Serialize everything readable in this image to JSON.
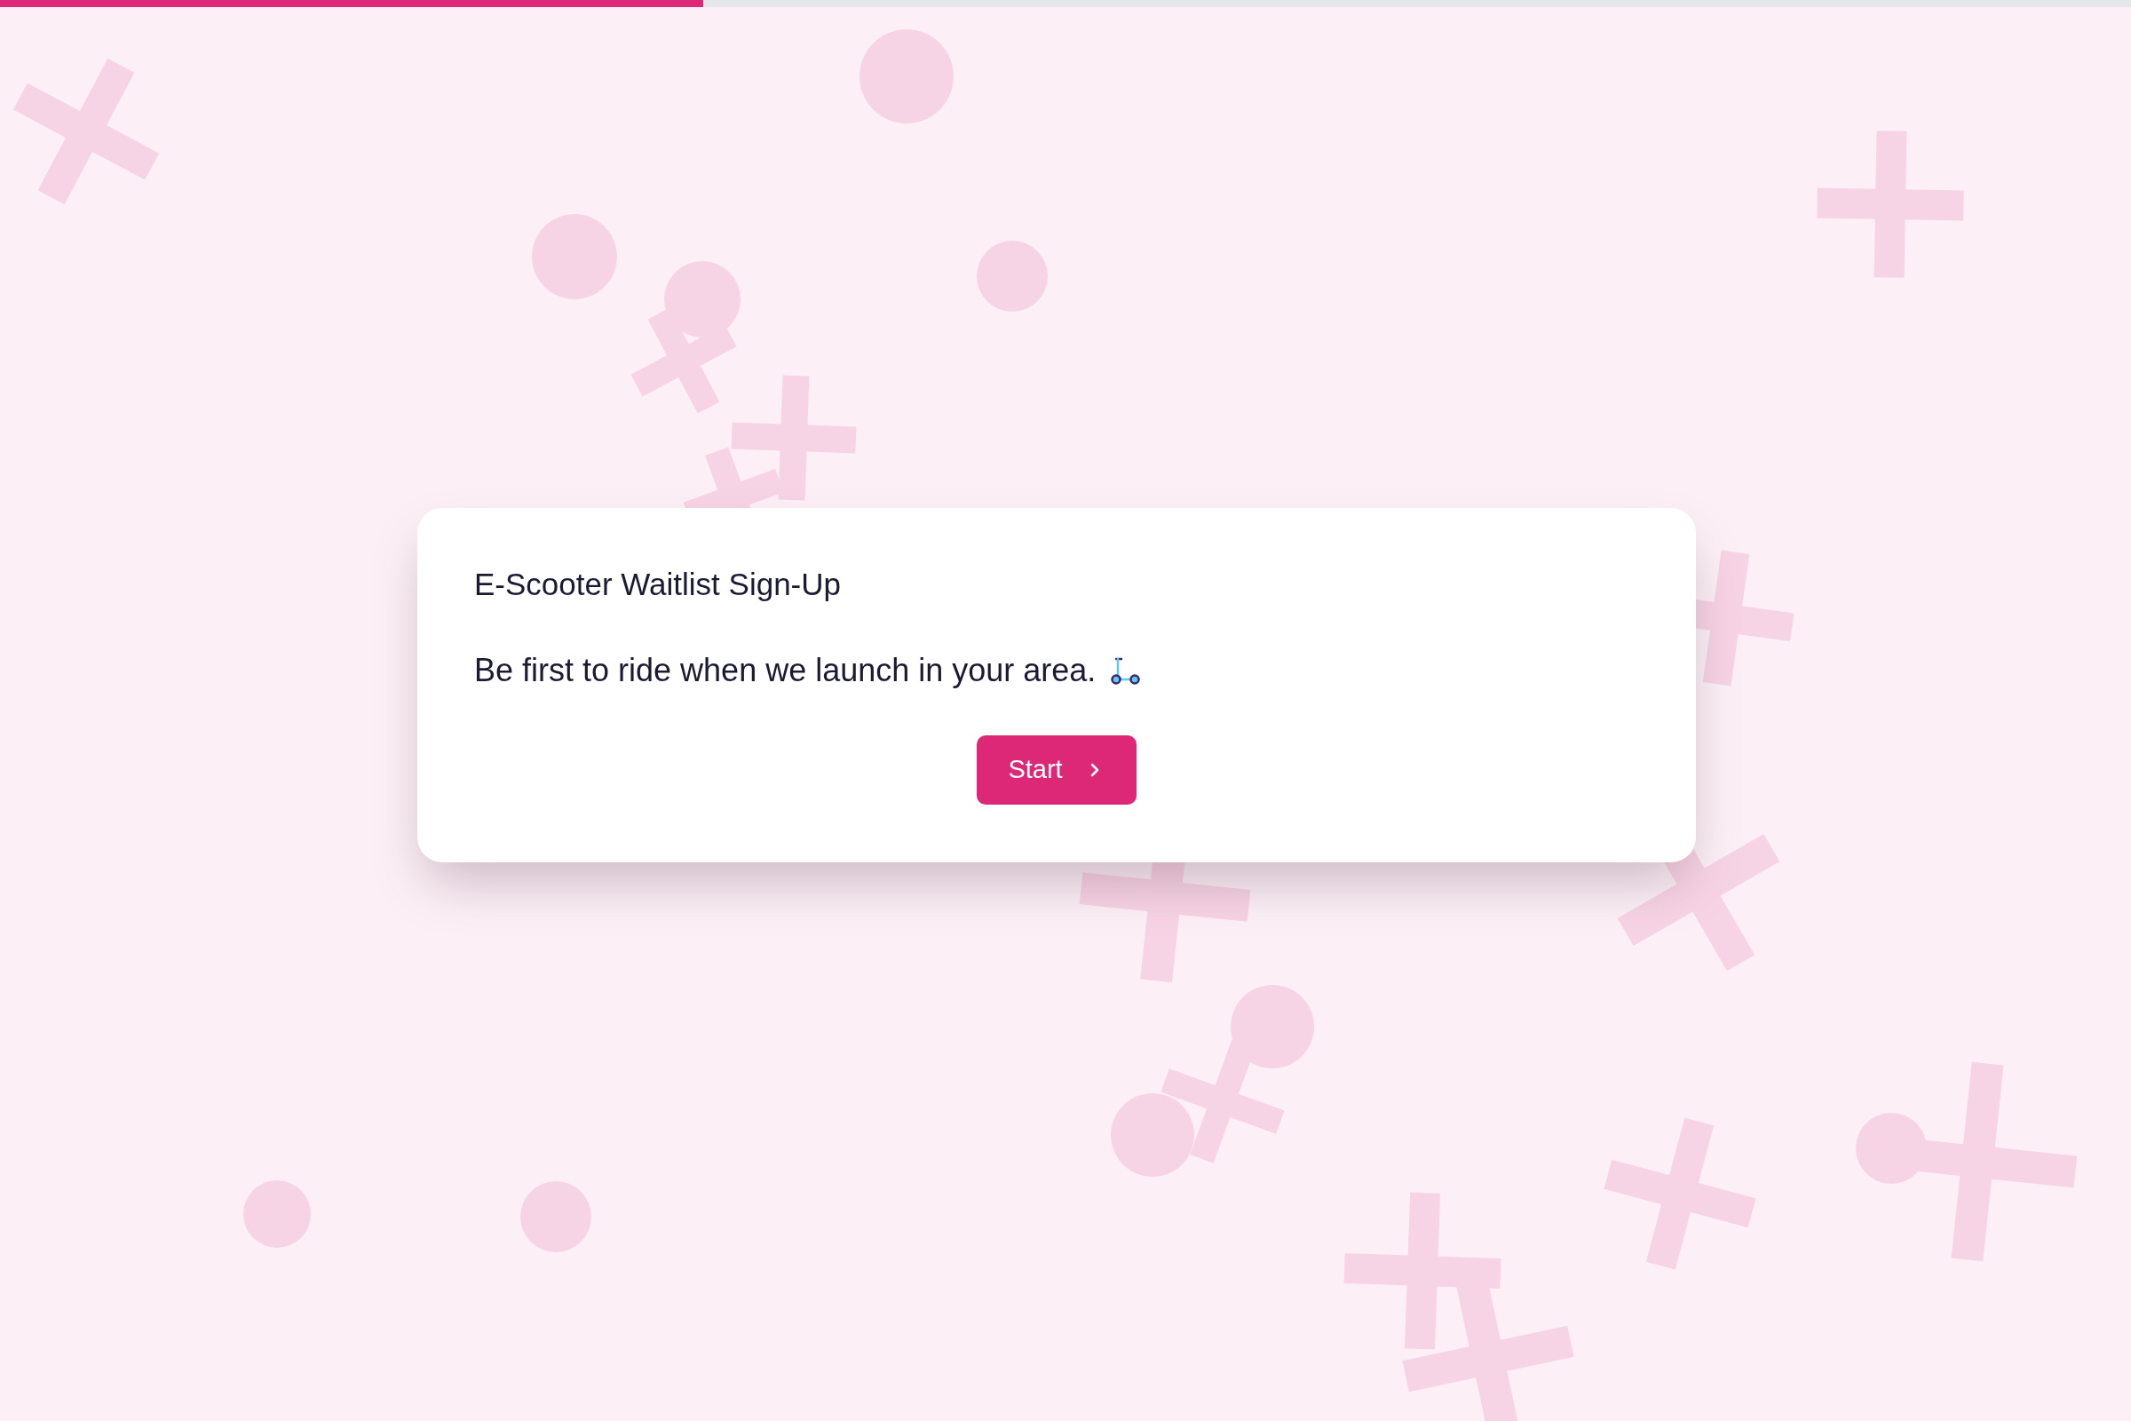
{
  "progress": {
    "level": 0.33
  },
  "card": {
    "title": "E-Scooter Waitlist Sign-Up",
    "subtitle": "Be first to ride when we launch in your area.",
    "button": {
      "label": "Start"
    }
  }
}
